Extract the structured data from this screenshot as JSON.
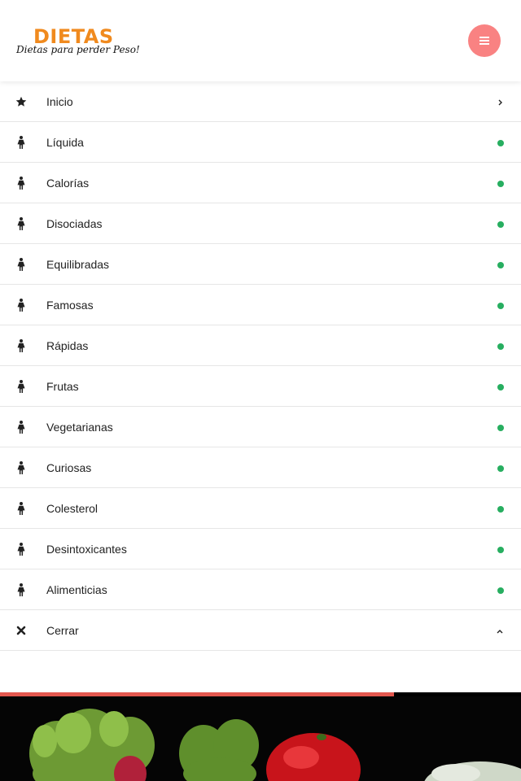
{
  "logo": {
    "title": "DIETAS",
    "subtitle": "Dietas para perder Peso!"
  },
  "header": {
    "menu_icon": "hamburger-icon",
    "menu_button_color": "#f98282"
  },
  "menu": {
    "items": [
      {
        "label": "Inicio",
        "icon": "star-icon",
        "indicator": "chevron-right"
      },
      {
        "label": "Líquida",
        "icon": "female-icon",
        "indicator": "dot"
      },
      {
        "label": "Calorías",
        "icon": "female-icon",
        "indicator": "dot"
      },
      {
        "label": "Disociadas",
        "icon": "female-icon",
        "indicator": "dot"
      },
      {
        "label": "Equilibradas",
        "icon": "female-icon",
        "indicator": "dot"
      },
      {
        "label": "Famosas",
        "icon": "female-icon",
        "indicator": "dot"
      },
      {
        "label": "Rápidas",
        "icon": "female-icon",
        "indicator": "dot"
      },
      {
        "label": "Frutas",
        "icon": "female-icon",
        "indicator": "dot"
      },
      {
        "label": "Vegetarianas",
        "icon": "female-icon",
        "indicator": "dot"
      },
      {
        "label": "Curiosas",
        "icon": "female-icon",
        "indicator": "dot"
      },
      {
        "label": "Colesterol",
        "icon": "female-icon",
        "indicator": "dot"
      },
      {
        "label": "Desintoxicantes",
        "icon": "female-icon",
        "indicator": "dot"
      },
      {
        "label": "Alimenticias",
        "icon": "female-icon",
        "indicator": "dot"
      },
      {
        "label": "Cerrar",
        "icon": "close-icon",
        "indicator": "chevron-up"
      }
    ]
  },
  "progress": {
    "value": 0.756,
    "color": "#e4584f"
  },
  "colors": {
    "logo": "#f08a1e",
    "dot": "#27ae60",
    "hero_bg": "#050505"
  },
  "hero": {
    "image": "vegetables-photo"
  }
}
